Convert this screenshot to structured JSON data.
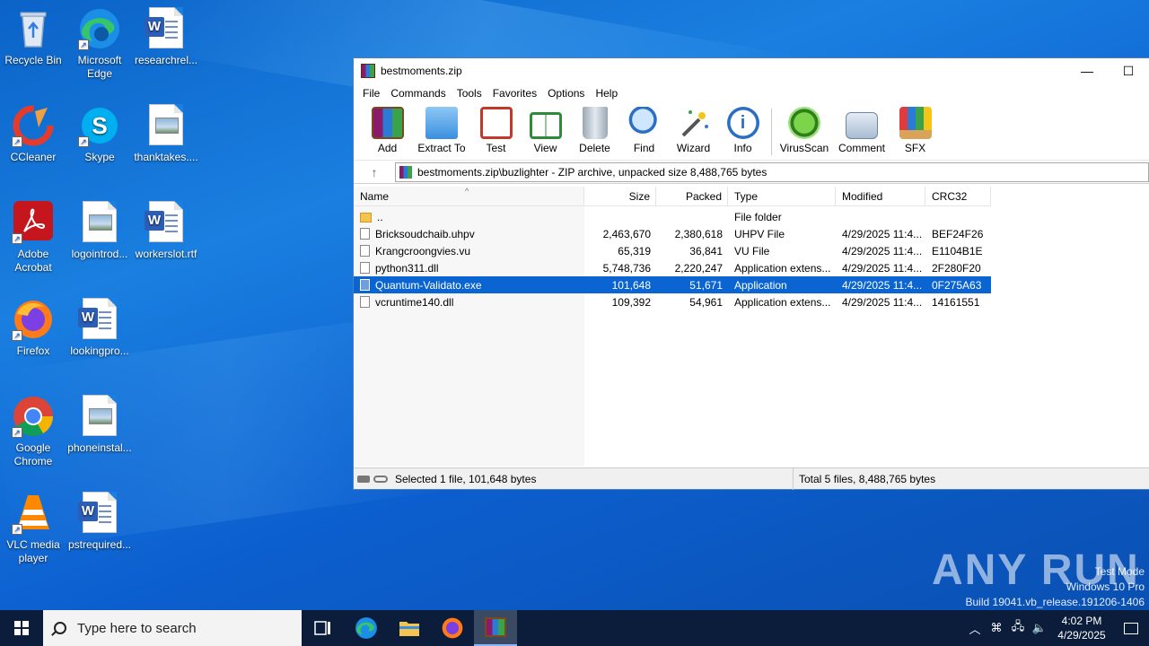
{
  "desktop": {
    "icons": [
      {
        "label": "Recycle Bin",
        "icon": "recycle-bin-icon"
      },
      {
        "label": "Microsoft Edge",
        "icon": "edge-icon"
      },
      {
        "label": "researchrel...",
        "icon": "word-doc-icon"
      },
      {
        "label": "CCleaner",
        "icon": "ccleaner-icon"
      },
      {
        "label": "Skype",
        "icon": "skype-icon"
      },
      {
        "label": "thanktakes....",
        "icon": "image-file-icon"
      },
      {
        "label": "Adobe Acrobat",
        "icon": "acrobat-icon"
      },
      {
        "label": "logointrod...",
        "icon": "image-file-icon"
      },
      {
        "label": "workerslot.rtf",
        "icon": "word-doc-icon"
      },
      {
        "label": "Firefox",
        "icon": "firefox-icon"
      },
      {
        "label": "lookingpro...",
        "icon": "word-doc-icon"
      },
      {
        "label": "Google Chrome",
        "icon": "chrome-icon"
      },
      {
        "label": "phoneinstal...",
        "icon": "image-file-icon"
      },
      {
        "label": "VLC media player",
        "icon": "vlc-icon"
      },
      {
        "label": "pstrequired...",
        "icon": "word-doc-icon"
      }
    ]
  },
  "window": {
    "title": "bestmoments.zip",
    "minimize": "—",
    "maximize": "☐",
    "menu": [
      "File",
      "Commands",
      "Tools",
      "Favorites",
      "Options",
      "Help"
    ],
    "toolbar": [
      {
        "label": "Add",
        "icon": "add-archive-icon"
      },
      {
        "label": "Extract To",
        "icon": "extract-folder-icon"
      },
      {
        "label": "Test",
        "icon": "test-clipboard-icon"
      },
      {
        "label": "View",
        "icon": "view-book-icon"
      },
      {
        "label": "Delete",
        "icon": "trash-icon"
      },
      {
        "label": "Find",
        "icon": "magnifier-icon"
      },
      {
        "label": "Wizard",
        "icon": "wizard-wand-icon"
      },
      {
        "label": "Info",
        "icon": "info-icon"
      },
      {
        "label": "VirusScan",
        "icon": "virus-scan-icon"
      },
      {
        "label": "Comment",
        "icon": "comment-icon"
      },
      {
        "label": "SFX",
        "icon": "sfx-box-icon"
      }
    ],
    "address": "bestmoments.zip\\buzlighter - ZIP archive, unpacked size 8,488,765 bytes",
    "columns": [
      "Name",
      "Size",
      "Packed",
      "Type",
      "Modified",
      "CRC32"
    ],
    "files": [
      {
        "name": "..",
        "size": "",
        "packed": "",
        "type": "File folder",
        "modified": "",
        "crc": "",
        "kind": "folder"
      },
      {
        "name": "Bricksoudchaib.uhpv",
        "size": "2,463,670",
        "packed": "2,380,618",
        "type": "UHPV File",
        "modified": "4/29/2025 11:4...",
        "crc": "BEF24F26",
        "kind": "file"
      },
      {
        "name": "Krangcroongvies.vu",
        "size": "65,319",
        "packed": "36,841",
        "type": "VU File",
        "modified": "4/29/2025 11:4...",
        "crc": "E1104B1E",
        "kind": "file"
      },
      {
        "name": "python311.dll",
        "size": "5,748,736",
        "packed": "2,220,247",
        "type": "Application extens...",
        "modified": "4/29/2025 11:4...",
        "crc": "2F280F20",
        "kind": "dll"
      },
      {
        "name": "Quantum-Validato.exe",
        "size": "101,648",
        "packed": "51,671",
        "type": "Application",
        "modified": "4/29/2025 11:4...",
        "crc": "0F275A63",
        "kind": "exe",
        "selected": true
      },
      {
        "name": "vcruntime140.dll",
        "size": "109,392",
        "packed": "54,961",
        "type": "Application extens...",
        "modified": "4/29/2025 11:4...",
        "crc": "14161551",
        "kind": "dll"
      }
    ],
    "status_left": "Selected 1 file, 101,648 bytes",
    "status_right": "Total 5 files, 8,488,765 bytes"
  },
  "watermark": {
    "logo": "ANY RUN",
    "line1": "Test Mode",
    "line2": "Windows 10 Pro",
    "line3": "Build 19041.vb_release.191206-1406"
  },
  "taskbar": {
    "search_placeholder": "Type here to search",
    "time": "4:02 PM",
    "date": "4/29/2025"
  }
}
